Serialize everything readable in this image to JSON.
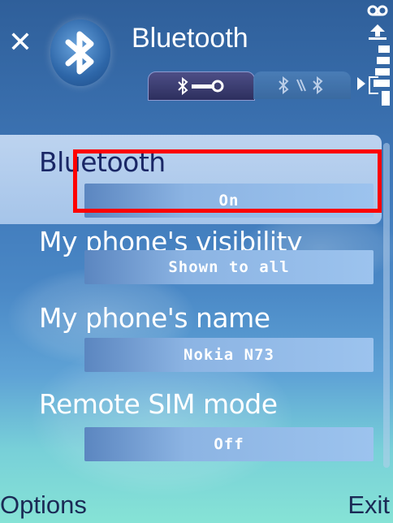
{
  "header": {
    "title": "Bluetooth",
    "close_icon": "close-icon",
    "app_icon": "bluetooth-icon",
    "tabs": [
      {
        "icon": "bluetooth-settings-icon",
        "active": true
      },
      {
        "icon": "bluetooth-paired-devices-icon",
        "active": false
      }
    ]
  },
  "settings": [
    {
      "label": "Bluetooth",
      "value": "On",
      "selected": true
    },
    {
      "label": "My phone's visibility",
      "value": "Shown to all",
      "selected": false
    },
    {
      "label": "My phone's name",
      "value": "Nokia N73",
      "selected": false
    },
    {
      "label": "Remote SIM mode",
      "value": "Off",
      "selected": false
    }
  ],
  "softkeys": {
    "left": "Options",
    "right": "Exit"
  },
  "colors": {
    "highlight": "#ff0000",
    "selected_text": "#1a2766",
    "text": "#ffffff"
  }
}
